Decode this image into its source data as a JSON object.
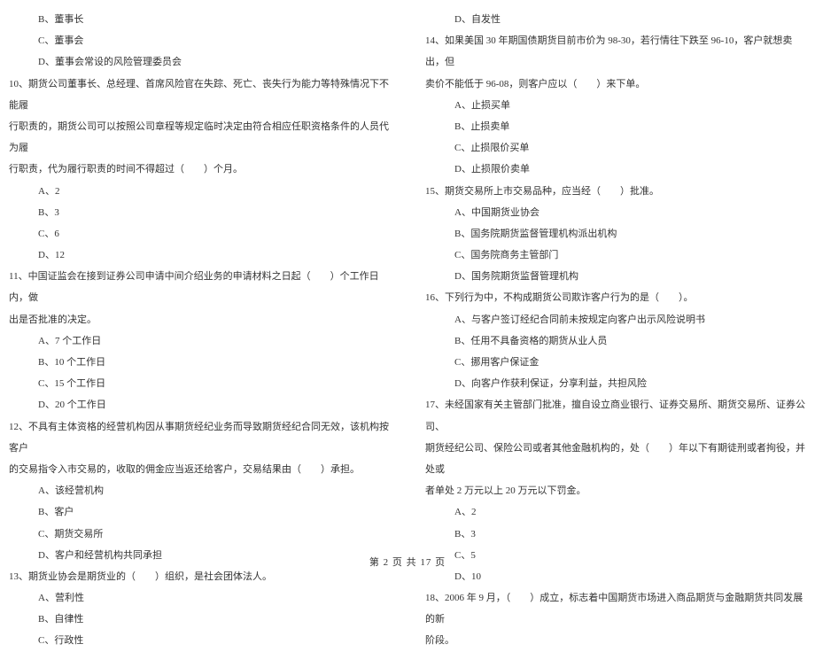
{
  "left_col": [
    {
      "cls": "option",
      "text": "B、董事长"
    },
    {
      "cls": "option",
      "text": "C、董事会"
    },
    {
      "cls": "option",
      "text": "D、董事会常设的风险管理委员会"
    },
    {
      "cls": "question",
      "text": "10、期货公司董事长、总经理、首席风险官在失踪、死亡、丧失行为能力等特殊情况下不能履"
    },
    {
      "cls": "question",
      "text": "行职责的，期货公司可以按照公司章程等规定临时决定由符合相应任职资格条件的人员代为履"
    },
    {
      "cls": "question",
      "text": "行职责，代为履行职责的时间不得超过（　　）个月。"
    },
    {
      "cls": "option",
      "text": "A、2"
    },
    {
      "cls": "option",
      "text": "B、3"
    },
    {
      "cls": "option",
      "text": "C、6"
    },
    {
      "cls": "option",
      "text": "D、12"
    },
    {
      "cls": "question",
      "text": "11、中国证监会在接到证券公司申请中间介绍业务的申请材料之日起（　　）个工作日内，做"
    },
    {
      "cls": "question",
      "text": "出是否批准的决定。"
    },
    {
      "cls": "option",
      "text": "A、7 个工作日"
    },
    {
      "cls": "option",
      "text": "B、10 个工作日"
    },
    {
      "cls": "option",
      "text": "C、15 个工作日"
    },
    {
      "cls": "option",
      "text": "D、20 个工作日"
    },
    {
      "cls": "question",
      "text": "12、不具有主体资格的经营机构因从事期货经纪业务而导致期货经纪合同无效，该机构按客户"
    },
    {
      "cls": "question",
      "text": "的交易指令入市交易的，收取的佣金应当返还给客户，交易结果由（　　）承担。"
    },
    {
      "cls": "option",
      "text": "A、该经营机构"
    },
    {
      "cls": "option",
      "text": "B、客户"
    },
    {
      "cls": "option",
      "text": "C、期货交易所"
    },
    {
      "cls": "option",
      "text": "D、客户和经营机构共同承担"
    },
    {
      "cls": "question",
      "text": "13、期货业协会是期货业的（　　）组织，是社会团体法人。"
    },
    {
      "cls": "option",
      "text": "A、营利性"
    },
    {
      "cls": "option",
      "text": "B、自律性"
    },
    {
      "cls": "option",
      "text": "C、行政性"
    }
  ],
  "right_col": [
    {
      "cls": "option",
      "text": "D、自发性"
    },
    {
      "cls": "question",
      "text": "14、如果美国 30 年期国债期货目前市价为 98-30，若行情往下跌至 96-10，客户就想卖出，但"
    },
    {
      "cls": "question",
      "text": "卖价不能低于 96-08，则客户应以（　　）来下单。"
    },
    {
      "cls": "option",
      "text": "A、止损买单"
    },
    {
      "cls": "option",
      "text": "B、止损卖单"
    },
    {
      "cls": "option",
      "text": "C、止损限价买单"
    },
    {
      "cls": "option",
      "text": "D、止损限价卖单"
    },
    {
      "cls": "question",
      "text": "15、期货交易所上市交易品种，应当经（　　）批准。"
    },
    {
      "cls": "option",
      "text": "A、中国期货业协会"
    },
    {
      "cls": "option",
      "text": "B、国务院期货监督管理机构派出机构"
    },
    {
      "cls": "option",
      "text": "C、国务院商务主管部门"
    },
    {
      "cls": "option",
      "text": "D、国务院期货监督管理机构"
    },
    {
      "cls": "question",
      "text": "16、下列行为中，不构成期货公司欺诈客户行为的是（　　）。"
    },
    {
      "cls": "option",
      "text": "A、与客户签订经纪合同前未按规定向客户出示风险说明书"
    },
    {
      "cls": "option",
      "text": "B、任用不具备资格的期货从业人员"
    },
    {
      "cls": "option",
      "text": "C、挪用客户保证金"
    },
    {
      "cls": "option",
      "text": "D、向客户作获利保证，分享利益，共担风险"
    },
    {
      "cls": "question",
      "text": "17、未经国家有关主管部门批准，擅自设立商业银行、证券交易所、期货交易所、证券公司、"
    },
    {
      "cls": "question",
      "text": "期货经纪公司、保险公司或者其他金融机构的，处（　　）年以下有期徒刑或者拘役，并处或"
    },
    {
      "cls": "question",
      "text": "者单处 2 万元以上 20 万元以下罚金。"
    },
    {
      "cls": "option",
      "text": "A、2"
    },
    {
      "cls": "option",
      "text": "B、3"
    },
    {
      "cls": "option",
      "text": "C、5"
    },
    {
      "cls": "option",
      "text": "D、10"
    },
    {
      "cls": "question",
      "text": "18、2006 年 9 月，（　　）成立，标志着中国期货市场进入商品期货与金融期货共同发展的新"
    },
    {
      "cls": "question",
      "text": "阶段。"
    }
  ],
  "footer": "第 2 页 共 17 页"
}
